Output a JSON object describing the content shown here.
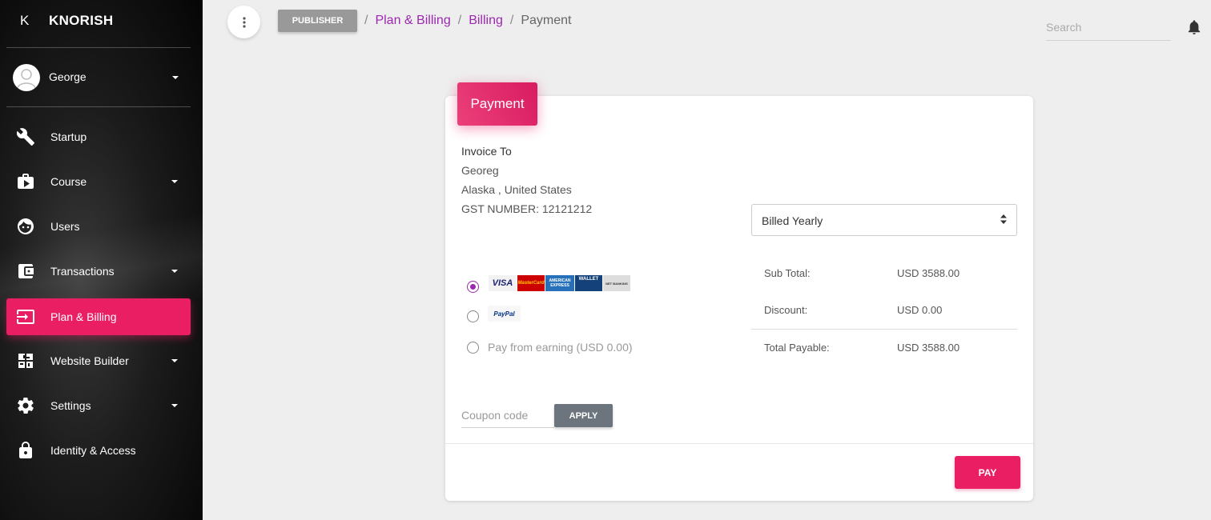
{
  "sidebar": {
    "logo_mark": "K",
    "brand": "KNORISH",
    "user_name": "George",
    "items": [
      {
        "label": "Startup",
        "icon": "wrench-icon",
        "has_caret": false
      },
      {
        "label": "Course",
        "icon": "video-library-icon",
        "has_caret": true
      },
      {
        "label": "Users",
        "icon": "face-icon",
        "has_caret": false
      },
      {
        "label": "Transactions",
        "icon": "wallet-icon",
        "has_caret": true
      },
      {
        "label": "Plan & Billing",
        "icon": "login-arrow-icon",
        "has_caret": false,
        "active": true
      },
      {
        "label": "Website Builder",
        "icon": "widgets-icon",
        "has_caret": true
      },
      {
        "label": "Settings",
        "icon": "gear-icon",
        "has_caret": true
      },
      {
        "label": "Identity & Access",
        "icon": "lock-icon",
        "has_caret": false
      }
    ]
  },
  "topbar": {
    "publisher_label": "PUBLISHER",
    "breadcrumbs": [
      "Plan & Billing",
      "Billing",
      "Payment"
    ],
    "search_placeholder": "Search"
  },
  "payment": {
    "tab_title": "Payment",
    "invoice_heading": "Invoice To",
    "invoice_name": "Georeg",
    "invoice_location": "Alaska , United States",
    "invoice_gst": "GST NUMBER: 12121212",
    "billing_cycle": "Billed Yearly",
    "methods": {
      "card_logos": [
        "VISA",
        "MasterCard",
        "AMERICAN EXPRESS",
        "WALLET",
        "NET BANKING"
      ],
      "paypal_label": "PayPal",
      "earning_label": "Pay from earning (USD 0.00)"
    },
    "summary": {
      "subtotal_label": "Sub Total:",
      "subtotal_value": "USD 3588.00",
      "discount_label": "Discount:",
      "discount_value": "USD 0.00",
      "total_label": "Total Payable:",
      "total_value": "USD 3588.00"
    },
    "coupon_placeholder": "Coupon code",
    "apply_label": "APPLY",
    "pay_label": "PAY"
  },
  "colors": {
    "accent": "#e91e63",
    "link": "#9c27b0",
    "sidebar_bg": "#111111"
  }
}
